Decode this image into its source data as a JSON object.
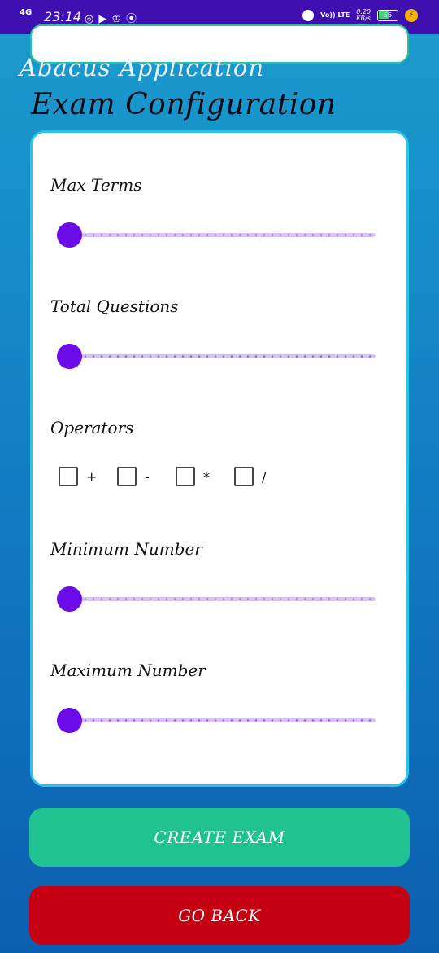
{
  "status_bar": {
    "network": "4G",
    "time": "23:14",
    "icons": [
      "whatsapp-icon",
      "youtube-icon",
      "trophy-icon",
      "hotspot-icon"
    ],
    "volte": "Vo)) LTE",
    "speed_value": "0.20",
    "speed_unit": "KB/s",
    "battery": "56"
  },
  "header": {
    "app_title": "Abacus Application",
    "page_title": "Exam Configuration"
  },
  "config": {
    "max_terms": {
      "label": "Max Terms",
      "value": 0
    },
    "total_questions": {
      "label": "Total Questions",
      "value": 0
    },
    "operators": {
      "label": "Operators",
      "items": [
        {
          "symbol": "+",
          "checked": false
        },
        {
          "symbol": "-",
          "checked": false
        },
        {
          "symbol": "*",
          "checked": false
        },
        {
          "symbol": "/",
          "checked": false
        }
      ]
    },
    "minimum_number": {
      "label": "Minimum Number",
      "value": 0
    },
    "maximum_number": {
      "label": "Maximum Number",
      "value": 0
    }
  },
  "actions": {
    "create_label": "CREATE EXAM",
    "back_label": "GO BACK"
  },
  "colors": {
    "accent": "#6b0be8",
    "create": "#20c290",
    "back": "#c50012",
    "status_bar": "#3f0fb0"
  }
}
